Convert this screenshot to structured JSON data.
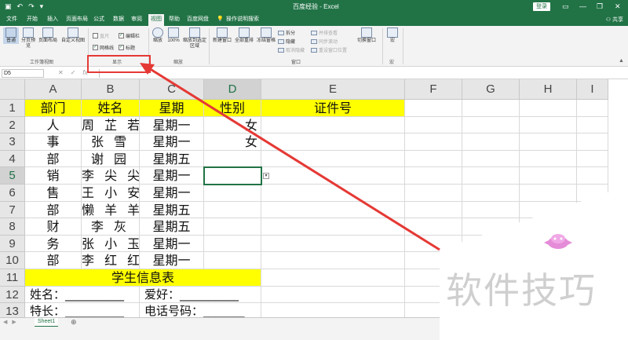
{
  "titlebar": {
    "title": "百度经验 - Excel",
    "login": "登录"
  },
  "menu": [
    "文件",
    "开始",
    "插入",
    "页面布局",
    "公式",
    "数据",
    "审阅",
    "视图",
    "帮助",
    "百度网盘"
  ],
  "menu_active_index": 7,
  "tell_me": "操作说明搜索",
  "share": "共享",
  "ribbon": {
    "views": {
      "normal": "普通",
      "page_break": "分页预览",
      "page_layout": "页面布局",
      "custom": "自定义视图",
      "group": "工作簿视图"
    },
    "show": {
      "ruler": "直尺",
      "formula_bar": "编辑栏",
      "gridlines": "网格线",
      "headings": "标题",
      "group": "显示"
    },
    "zoom": {
      "zoom": "缩放",
      "hundred": "100%",
      "to_selection": "缩放到选定区域",
      "group": "缩放"
    },
    "window": {
      "new": "新建窗口",
      "arrange": "全部重排",
      "freeze": "冻结窗格",
      "split": "拆分",
      "hide": "隐藏",
      "unhide": "取消隐藏",
      "side_by_side": "并排查看",
      "sync_scroll": "同步滚动",
      "reset_pos": "重设窗口位置",
      "switch": "切换窗口",
      "group": "窗口"
    },
    "macros": {
      "macros": "宏",
      "group": "宏"
    }
  },
  "formula": {
    "namebox": "D5",
    "fx": "fx"
  },
  "columns": [
    "A",
    "B",
    "C",
    "D",
    "E",
    "F",
    "G",
    "H",
    "I"
  ],
  "rows": [
    "1",
    "2",
    "3",
    "4",
    "5",
    "6",
    "7",
    "8",
    "9",
    "10",
    "11",
    "12",
    "13"
  ],
  "cells": {
    "A1": "部门",
    "B1": "姓名",
    "C1": "星期",
    "D1": "性别",
    "E1": "证件号",
    "A2": "人",
    "B2": "周 芷 若",
    "C2": "星期一",
    "D2": "女",
    "A3": "事",
    "B3": "张 雪",
    "C3": "星期一",
    "D3": "女",
    "A4": "部",
    "B4": "谢 园",
    "C4": "星期五",
    "A5": "销",
    "B5": "李 尖 尖",
    "C5": "星期一",
    "A6": "售",
    "B6": "王 小 安",
    "C6": "星期一",
    "A7": "部",
    "B7": "懒 羊 羊",
    "C7": "星期五",
    "A8": "财",
    "B8": "李 灰",
    "C8": "星期五",
    "A9": "务",
    "B9": "张 小 玉",
    "C9": "星期一",
    "A10": "部",
    "B10": "李 红 红",
    "C10": "星期一",
    "A11": "学生信息表",
    "A12": "姓名：__________",
    "C12": "爱好：__________",
    "A13": "特长：__________",
    "C13": "电话号码：_______"
  },
  "sheet": {
    "name": "Sheet1",
    "add": "⊕"
  },
  "watermark": "软件技巧",
  "colors": {
    "excel_green": "#217346",
    "yellow": "#ffff00",
    "arrow_red": "#e53935"
  }
}
